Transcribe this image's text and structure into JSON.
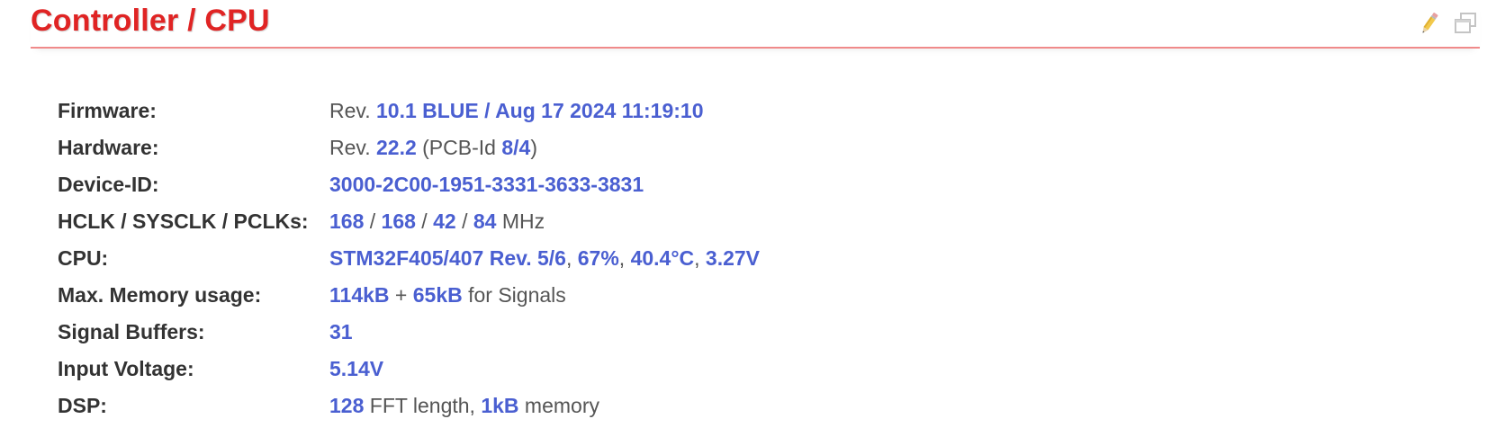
{
  "panel": {
    "title": "Controller / CPU",
    "icons": [
      "pencil-icon",
      "window-copy-icon"
    ]
  },
  "rows": {
    "firmware": {
      "label": "Firmware:",
      "prefix": "Rev. ",
      "value": "10.1 BLUE / Aug 17 2024 11:19:10"
    },
    "hardware": {
      "label": "Hardware:",
      "prefix": "Rev. ",
      "rev": "22.2",
      "pcb_text": " (PCB-Id ",
      "pcb_id": "8/4",
      "close": ")"
    },
    "device_id": {
      "label": "Device-ID:",
      "value": "3000-2C00-1951-3331-3633-3831"
    },
    "clocks": {
      "label": "HCLK / SYSCLK / PCLKs:",
      "hclk": "168",
      "sep1": " / ",
      "sysclk": "168",
      "sep2": " / ",
      "pclk1": "42",
      "sep3": " / ",
      "pclk2": "84",
      "unit": " MHz"
    },
    "cpu": {
      "label": "CPU:",
      "model": "STM32F405/407 Rev. 5/6",
      "sep1": ", ",
      "load": "67%",
      "sep2": ", ",
      "temp": "40.4°C",
      "sep3": ", ",
      "voltage": "3.27V"
    },
    "memory": {
      "label": "Max. Memory usage:",
      "mem": "114kB",
      "plus": " + ",
      "signal_mem": "65kB",
      "suffix": " for Signals"
    },
    "signal_buffers": {
      "label": "Signal Buffers:",
      "value": "31"
    },
    "input_voltage": {
      "label": "Input Voltage:",
      "value": "5.14V"
    },
    "dsp": {
      "label": "DSP:",
      "fft": "128",
      "fft_text": " FFT length, ",
      "memory": "1kB",
      "memory_text": " memory"
    }
  }
}
